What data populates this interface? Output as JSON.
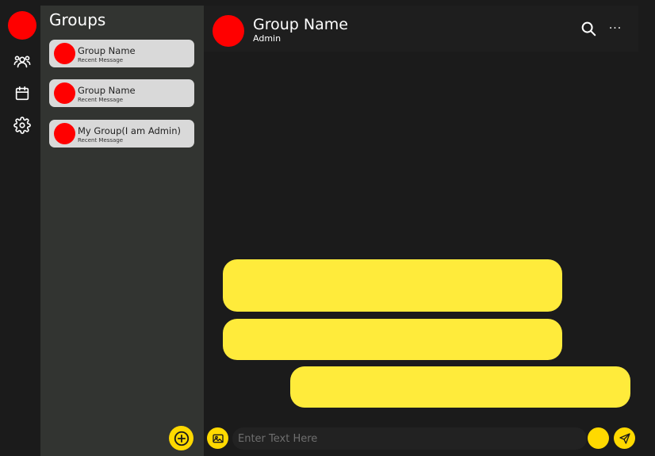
{
  "groups_panel": {
    "title": "Groups",
    "items": [
      {
        "name": "Group Name",
        "recent": "Recent Message"
      },
      {
        "name": "Group Name",
        "recent": "Recent Message"
      },
      {
        "name": "My Group(I am Admin)",
        "recent": "Recent Message"
      }
    ]
  },
  "chat_header": {
    "name": "Group Name",
    "role": "Admin",
    "more_label": "···"
  },
  "composer": {
    "placeholder": "Enter Text Here",
    "value": ""
  },
  "colors": {
    "avatar": "#ff0000",
    "bubble": "#ffeb3b",
    "accent": "#ffd900",
    "panel": "#323431",
    "card": "#d9d9d9"
  },
  "icons": {
    "rail": [
      "users-icon",
      "calendar-icon",
      "gear-icon"
    ],
    "header": [
      "search-icon",
      "more-icon"
    ],
    "composer": [
      "image-icon",
      "emoji-icon",
      "send-icon"
    ],
    "panel": [
      "plus-circle-icon"
    ]
  }
}
